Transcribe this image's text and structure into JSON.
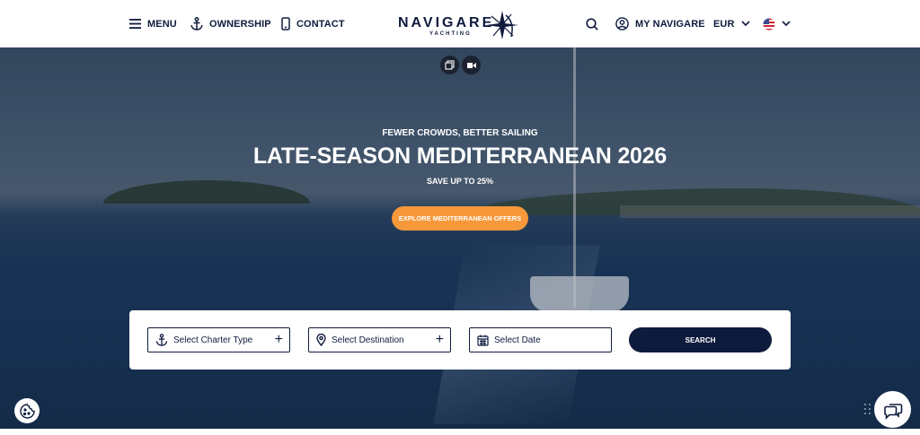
{
  "header": {
    "menu_label": "MENU",
    "ownership_label": "OWNERSHIP",
    "contact_label": "CONTACT",
    "logo_word": "NAVIGARE",
    "logo_sub": "YACHTING",
    "account_label": "MY NAVIGARE",
    "currency_label": "EUR",
    "icons": [
      "menu-icon",
      "anchor-icon",
      "phone-icon",
      "compass-star-icon",
      "search-icon",
      "user-icon",
      "chevron-down-icon",
      "us-flag-icon"
    ]
  },
  "hero": {
    "eyebrow": "FEWER CROWDS, BETTER SAILING",
    "headline": "LATE-SEASON MEDITERRANEAN 2026",
    "subline": "SAVE UP TO 25%",
    "cta_label": "EXPLORE MEDITERRANEAN OFFERS",
    "media_icons": [
      "gallery-icon",
      "video-icon"
    ]
  },
  "search": {
    "charter_type_placeholder": "Select Charter Type",
    "destination_placeholder": "Select Destination",
    "date_placeholder": "Select Date",
    "search_label": "SEARCH"
  },
  "floating": {
    "cookie_icon": "cookie-icon",
    "chat_icon": "chat-icon"
  },
  "colors": {
    "navy": "#0f1b3d",
    "accent_orange": "#f7983a",
    "white": "#ffffff"
  }
}
